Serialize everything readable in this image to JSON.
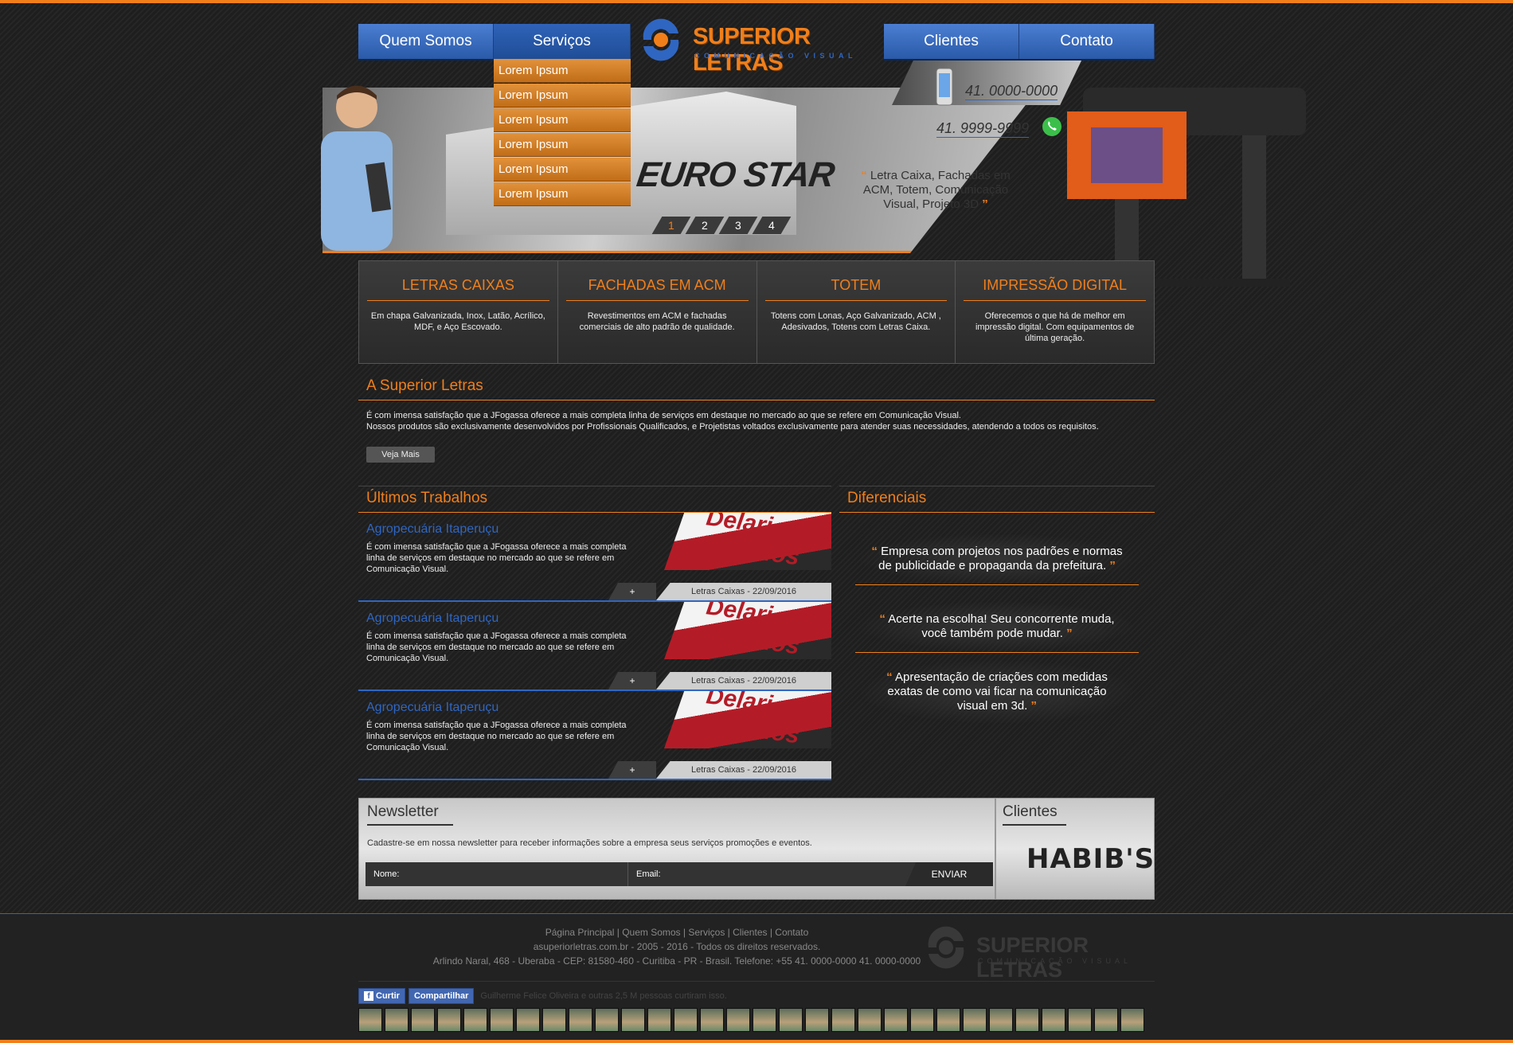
{
  "nav": {
    "items": [
      "Quem Somos",
      "Serviços",
      "Clientes",
      "Contato"
    ],
    "active": "Serviços",
    "dropdown": [
      "Lorem Ipsum",
      "Lorem Ipsum",
      "Lorem Ipsum",
      "Lorem Ipsum",
      "Lorem Ipsum",
      "Lorem Ipsum"
    ]
  },
  "logo": {
    "title": "SUPERIOR LETRAS",
    "subtitle": "COMUNICAÇÃO VISUAL"
  },
  "banner": {
    "sign_text": "EURO STAR",
    "slides": [
      "1",
      "2",
      "3",
      "4"
    ],
    "active_slide": 1,
    "phone1": "41. 0000-0000",
    "phone2": "41. 9999-9999",
    "tagline": "Letra Caixa, Fachadas em ACM, Totem, Comunicação Visual, Projeto 3D"
  },
  "services": [
    {
      "title": "LETRAS CAIXAS",
      "text": "Em chapa Galvanizada, Inox, Latão, Acrílico, MDF, e Aço Escovado."
    },
    {
      "title": "FACHADAS EM ACM",
      "text": "Revestimentos em ACM e fachadas comerciais de alto padrão de qualidade."
    },
    {
      "title": "TOTEM",
      "text": "Totens com Lonas, Aço Galvanizado, ACM , Adesivados, Totens com Letras Caixa."
    },
    {
      "title": "IMPRESSÃO DIGITAL",
      "text": "Oferecemos o que há de melhor em impressão digital. Com equipamentos de última geração."
    }
  ],
  "about": {
    "title": "A Superior Letras",
    "line1": "É com imensa satisfação que a JFogassa oferece a mais completa linha de serviços em destaque no mercado ao que se refere em Comunicação Visual.",
    "line2": "Nossos produtos são exclusivamente desenvolvidos por Profissionais Qualificados, e Projetistas voltados exclusivamente para atender suas necessidades, atendendo a todos os requisitos.",
    "button": "Veja Mais"
  },
  "works": {
    "title": "Últimos Trabalhos",
    "items": [
      {
        "title": "Agropecuária Itaperuçu",
        "text": "É com imensa satisfação que a JFogassa oferece a mais completa linha de serviços em destaque no mercado ao que se refere em Comunicação Visual.",
        "image_text": "Delari Veículos",
        "plus": "+",
        "tag": "Letras Caixas - 22/09/2016"
      },
      {
        "title": "Agropecuária Itaperuçu",
        "text": "É com imensa satisfação que a JFogassa oferece a mais completa linha de serviços em destaque no mercado ao que se refere em Comunicação Visual.",
        "image_text": "Delari Veículos",
        "plus": "+",
        "tag": "Letras Caixas - 22/09/2016"
      },
      {
        "title": "Agropecuária Itaperuçu",
        "text": "É com imensa satisfação que a JFogassa oferece a mais completa linha de serviços em destaque no mercado ao que se refere em Comunicação Visual.",
        "image_text": "Delari Veículos",
        "plus": "+",
        "tag": "Letras Caixas - 22/09/2016"
      }
    ]
  },
  "diferenciais": {
    "title": "Diferenciais",
    "items": [
      "Empresa com projetos nos padrões e normas de publicidade e propaganda da prefeitura.",
      "Acerte na escolha!  Seu concorrente muda, você também pode mudar.",
      "Apresentação de criações com medidas exatas de como vai ficar na comunicação visual em 3d."
    ]
  },
  "newsletter": {
    "title": "Newsletter",
    "desc": "Cadastre-se em nossa newsletter para receber informações sobre a empresa seus serviços promoções e eventos.",
    "name_label": "Nome:",
    "email_label": "Email:",
    "button": "ENVIAR"
  },
  "clients": {
    "title": "Clientes",
    "logo_text": "HABIB'S"
  },
  "footer": {
    "links": "Página Principal | Quem Somos | Serviços | Clientes | Contato",
    "copyright": "asuperiorletras.com.br - 2005 - 2016 - Todos os direitos reservados.",
    "address": "Arlindo Naral, 468 - Uberaba - CEP: 81580-460 - Curitiba - PR - Brasil. Telefone: +55 41. 0000-0000 41. 0000-0000",
    "fb_like": "Curtir",
    "fb_share": "Compartilhar",
    "fb_text": "Guilherme Felice Oliveira e outras 2,5 M pessoas curtiram isso."
  },
  "colors": {
    "accent": "#f07f1b",
    "nav_blue": "#2f66c2",
    "bg": "#1e1e1e"
  }
}
